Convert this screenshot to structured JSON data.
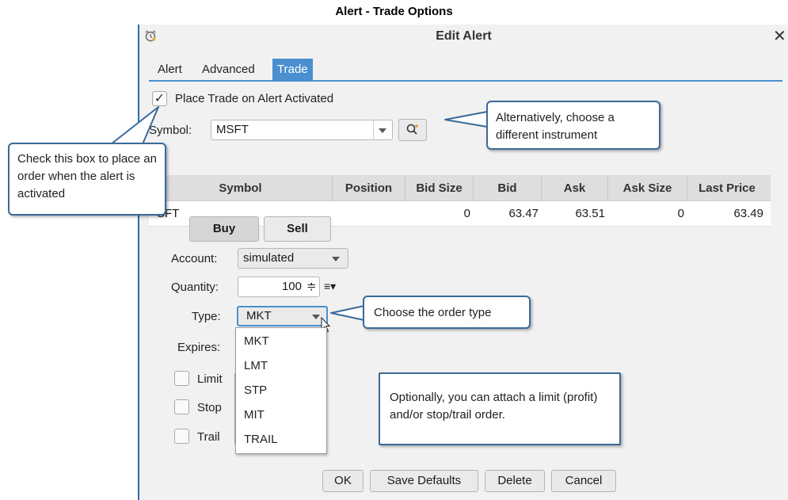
{
  "caption": "Alert - Trade Options",
  "dialog": {
    "title": "Edit Alert",
    "close": "✕"
  },
  "tabs": [
    {
      "label": "Alert",
      "active": false
    },
    {
      "label": "Advanced",
      "active": false
    },
    {
      "label": "Trade",
      "active": true
    }
  ],
  "place_trade": {
    "label": "Place Trade on Alert Activated",
    "checked": true,
    "mark": "✓"
  },
  "symbol": {
    "label": "Symbol:",
    "value": "MSFT"
  },
  "grid": {
    "headers": [
      "Symbol",
      "Position",
      "Bid Size",
      "Bid",
      "Ask",
      "Ask Size",
      "Last Price"
    ],
    "row": {
      "symbol": "SFT",
      "position": "",
      "bid_size": "0",
      "bid": "63.47",
      "ask": "63.51",
      "ask_size": "0",
      "last_price": "63.49"
    }
  },
  "buttons": {
    "buy": "Buy",
    "sell": "Sell",
    "ok": "OK",
    "save_defaults": "Save Defaults",
    "delete": "Delete",
    "cancel": "Cancel"
  },
  "account": {
    "label": "Account:",
    "value": "simulated"
  },
  "quantity": {
    "label": "Quantity:",
    "value": "100",
    "spinner": "≑",
    "menu": "≡▾"
  },
  "type": {
    "label": "Type:",
    "value": "MKT",
    "options": [
      "MKT",
      "LMT",
      "STP",
      "MIT",
      "TRAIL"
    ]
  },
  "expires": {
    "label": "Expires:"
  },
  "attached": {
    "limit": "Limit",
    "stop": "Stop",
    "trail": "Trail"
  },
  "callouts": {
    "checkbox": "Check this box to place an order when the alert is activated",
    "instrument": "Alternatively, choose a different instrument",
    "order_type": "Choose the order type",
    "attach": "Optionally, you can attach a limit (profit) and/or stop/trail order."
  },
  "colors": {
    "accent": "#4a8fd0",
    "callout_border": "#3a6a98",
    "dialog_bg": "#f1f1f1"
  }
}
